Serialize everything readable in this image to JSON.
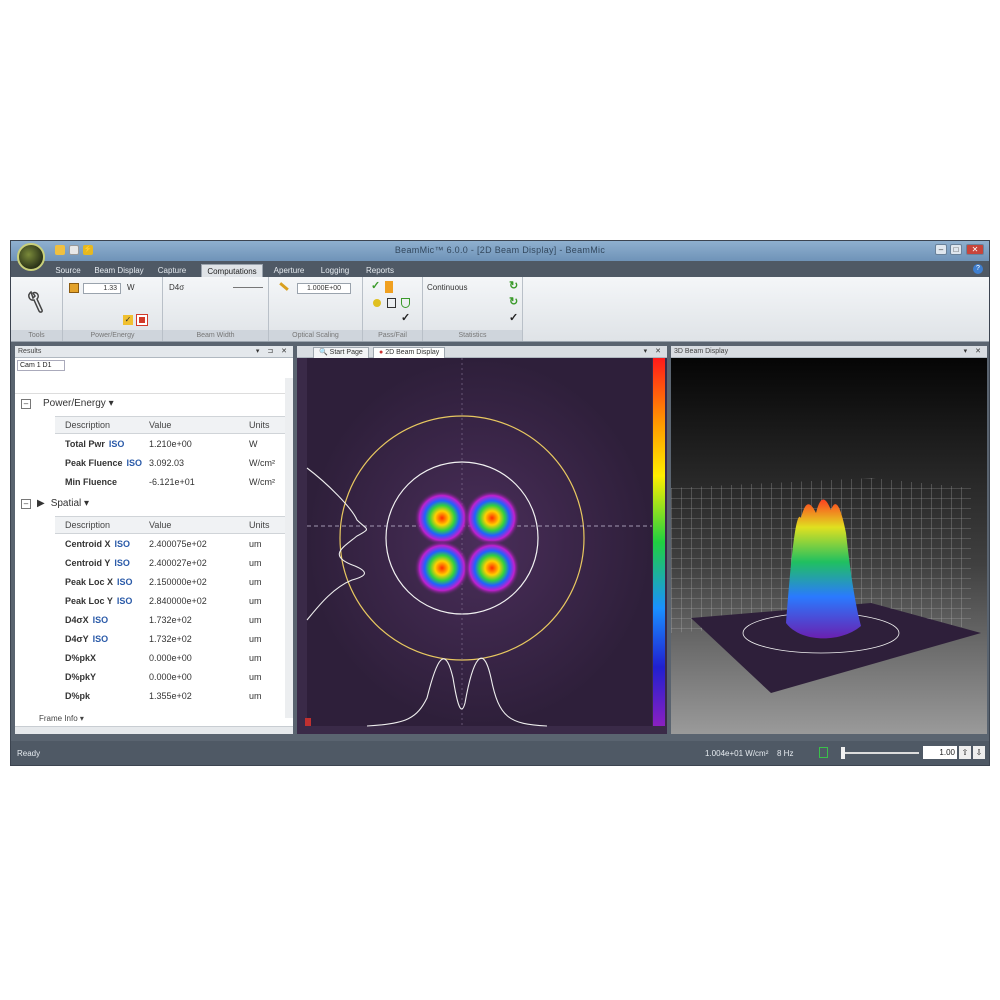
{
  "window": {
    "title": "BeamMic™ 6.0.0 - [2D Beam Display] - BeamMic",
    "minimize": "–",
    "maximize": "□",
    "close": "✕"
  },
  "ribbon_tabs": [
    "Source",
    "Beam Display",
    "Capture",
    "Computations",
    "Aperture",
    "Logging",
    "Reports"
  ],
  "active_tab": "Computations",
  "ribbon": {
    "groups": [
      "Tools",
      "Power/Energy",
      "Beam Width",
      "Optical Scaling",
      "Pass/Fail",
      "Statistics"
    ],
    "power_value": "1.33",
    "power_unit": "W",
    "beam_width_mode": "D4σ",
    "scale_value": "1.000E+00",
    "statistics_mode": "Continuous"
  },
  "results_pane": {
    "title": "Results",
    "dropdown": "Cam 1 D1",
    "sections": [
      {
        "name": "Power/Energy",
        "headers": [
          "Description",
          "Value",
          "Units"
        ],
        "rows": [
          {
            "desc": "Total Pwr",
            "iso": "ISO",
            "value": "1.210e+00",
            "unit": "W"
          },
          {
            "desc": "Peak Fluence",
            "iso": "ISO",
            "value": "3.092.03",
            "unit": "W/cm²"
          },
          {
            "desc": "Min Fluence",
            "iso": "",
            "value": "-6.121e+01",
            "unit": "W/cm²"
          }
        ]
      },
      {
        "name": "Spatial",
        "headers": [
          "Description",
          "Value",
          "Units"
        ],
        "rows": [
          {
            "desc": "Centroid X",
            "iso": "ISO",
            "value": "2.400075e+02",
            "unit": "um"
          },
          {
            "desc": "Centroid Y",
            "iso": "ISO",
            "value": "2.400027e+02",
            "unit": "um"
          },
          {
            "desc": "Peak Loc X",
            "iso": "ISO",
            "value": "2.150000e+02",
            "unit": "um"
          },
          {
            "desc": "Peak Loc Y",
            "iso": "ISO",
            "value": "2.840000e+02",
            "unit": "um"
          },
          {
            "desc": "D4σX",
            "iso": "ISO",
            "value": "1.732e+02",
            "unit": "um"
          },
          {
            "desc": "D4σY",
            "iso": "ISO",
            "value": "1.732e+02",
            "unit": "um"
          },
          {
            "desc": "D%pkX",
            "iso": "",
            "value": "0.000e+00",
            "unit": "um"
          },
          {
            "desc": "D%pkY",
            "iso": "",
            "value": "0.000e+00",
            "unit": "um"
          },
          {
            "desc": "D%pk",
            "iso": "",
            "value": "1.355e+02",
            "unit": "um"
          }
        ]
      }
    ],
    "footer_section": "Frame Info"
  },
  "view_tabs": {
    "start_page": "Start Page",
    "display_2d": "2D Beam Display",
    "display_3d": "3D Beam Display"
  },
  "status": {
    "text": "Ready",
    "readout": "1.004e+01 W/cm²",
    "hz": "8 Hz",
    "zoom_value": "1.00"
  },
  "colors": {
    "accent_tab": "#dfe3e7",
    "beam_bg": "#2e1f3a",
    "check": "#3a9a2a"
  }
}
